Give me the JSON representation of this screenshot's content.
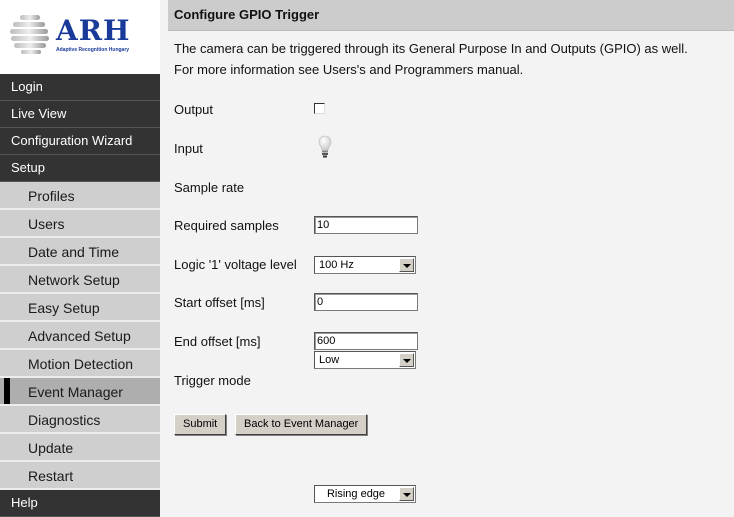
{
  "logo": {
    "brand": "ARH",
    "tagline": "Adaptive Recognition Hungary",
    "brand_color": "#1a3a9a"
  },
  "sidebar": {
    "items": [
      {
        "label": "Login",
        "level": "top"
      },
      {
        "label": "Live View",
        "level": "top"
      },
      {
        "label": "Configuration Wizard",
        "level": "top"
      },
      {
        "label": "Setup",
        "level": "top"
      },
      {
        "label": "Profiles",
        "level": "sub"
      },
      {
        "label": "Users",
        "level": "sub"
      },
      {
        "label": "Date and Time",
        "level": "sub"
      },
      {
        "label": "Network Setup",
        "level": "sub"
      },
      {
        "label": "Easy Setup",
        "level": "sub"
      },
      {
        "label": "Advanced Setup",
        "level": "sub"
      },
      {
        "label": "Motion Detection",
        "level": "sub"
      },
      {
        "label": "Event Manager",
        "level": "sub",
        "active": true
      },
      {
        "label": "Diagnostics",
        "level": "sub"
      },
      {
        "label": "Update",
        "level": "sub"
      },
      {
        "label": "Restart",
        "level": "sub"
      },
      {
        "label": "Help",
        "level": "top"
      }
    ]
  },
  "page": {
    "title": "Configure GPIO Trigger",
    "description_line1": "The camera can be triggered through its General Purpose In and Outputs (GPIO) as well.",
    "description_line2": "For more information see Users's and Programmers manual."
  },
  "form": {
    "output": {
      "label": "Output",
      "checked": false
    },
    "input": {
      "label": "Input",
      "icon": "lightbulb-off-icon"
    },
    "sample_rate": {
      "label": "Sample rate",
      "value": "100 Hz"
    },
    "required_samples": {
      "label": "Required samples",
      "value": "10"
    },
    "logic_level": {
      "label": "Logic '1' voltage level",
      "value": "Low"
    },
    "start_offset": {
      "label": "Start offset [ms]",
      "value": "0"
    },
    "end_offset": {
      "label": "End offset [ms]",
      "value": "600"
    },
    "trigger_mode": {
      "label": "Trigger mode",
      "value": "Rising edge"
    }
  },
  "buttons": {
    "submit": "Submit",
    "back": "Back to Event Manager"
  }
}
